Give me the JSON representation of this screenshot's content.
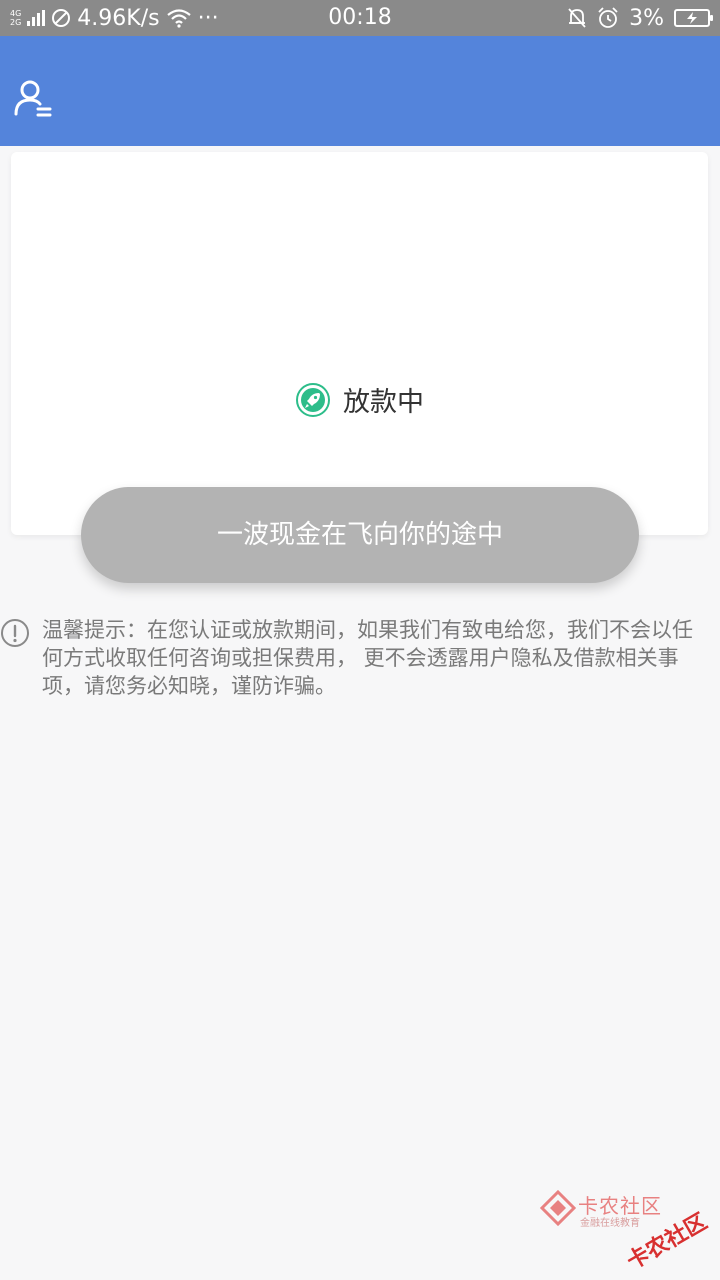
{
  "status_bar": {
    "network_top": "4G",
    "network_bottom": "2G",
    "speed": "4.96K/s",
    "overflow": "···",
    "time": "00:18",
    "battery": "3%"
  },
  "header": {
    "profile_icon": "user-menu-icon"
  },
  "loan_status": {
    "icon": "rocket-icon",
    "label": "放款中",
    "accent": "#2dbd8a"
  },
  "cta": {
    "label": "一波现金在飞向你的途中",
    "color": "#b3b3b3"
  },
  "notice": {
    "icon": "alert-circle-icon",
    "text": "温馨提示：在您认证或放款期间，如果我们有致电给您，我们不会以任何方式收取任何咨询或担保费用， 更不会透露用户隐私及借款相关事项，请您务必知晓，谨防诈骗。"
  },
  "watermark": {
    "brand": "卡农社区",
    "sub": "金融在线教育",
    "stamp": "卡农社区"
  },
  "colors": {
    "header": "#5484db",
    "status_bar": "#8a8a8a",
    "background": "#f7f7f8"
  }
}
